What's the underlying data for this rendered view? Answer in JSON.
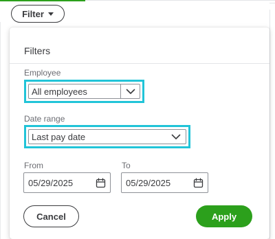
{
  "toolbar": {
    "filter_label": "Filter",
    "filter_icon": "caret-down-icon"
  },
  "panel": {
    "title": "Filters",
    "employee": {
      "label": "Employee",
      "value": "All employees",
      "icon": "chevron-down-icon"
    },
    "date_range": {
      "label": "Date range",
      "value": "Last pay date",
      "icon": "chevron-down-icon"
    },
    "from": {
      "label": "From",
      "value": "05/29/2025",
      "icon": "calendar-icon"
    },
    "to": {
      "label": "To",
      "value": "05/29/2025",
      "icon": "calendar-icon"
    },
    "cancel_label": "Cancel",
    "apply_label": "Apply"
  },
  "colors": {
    "brand_green": "#2ca01c",
    "highlight": "#21c4d8",
    "text": "#393a3d"
  }
}
